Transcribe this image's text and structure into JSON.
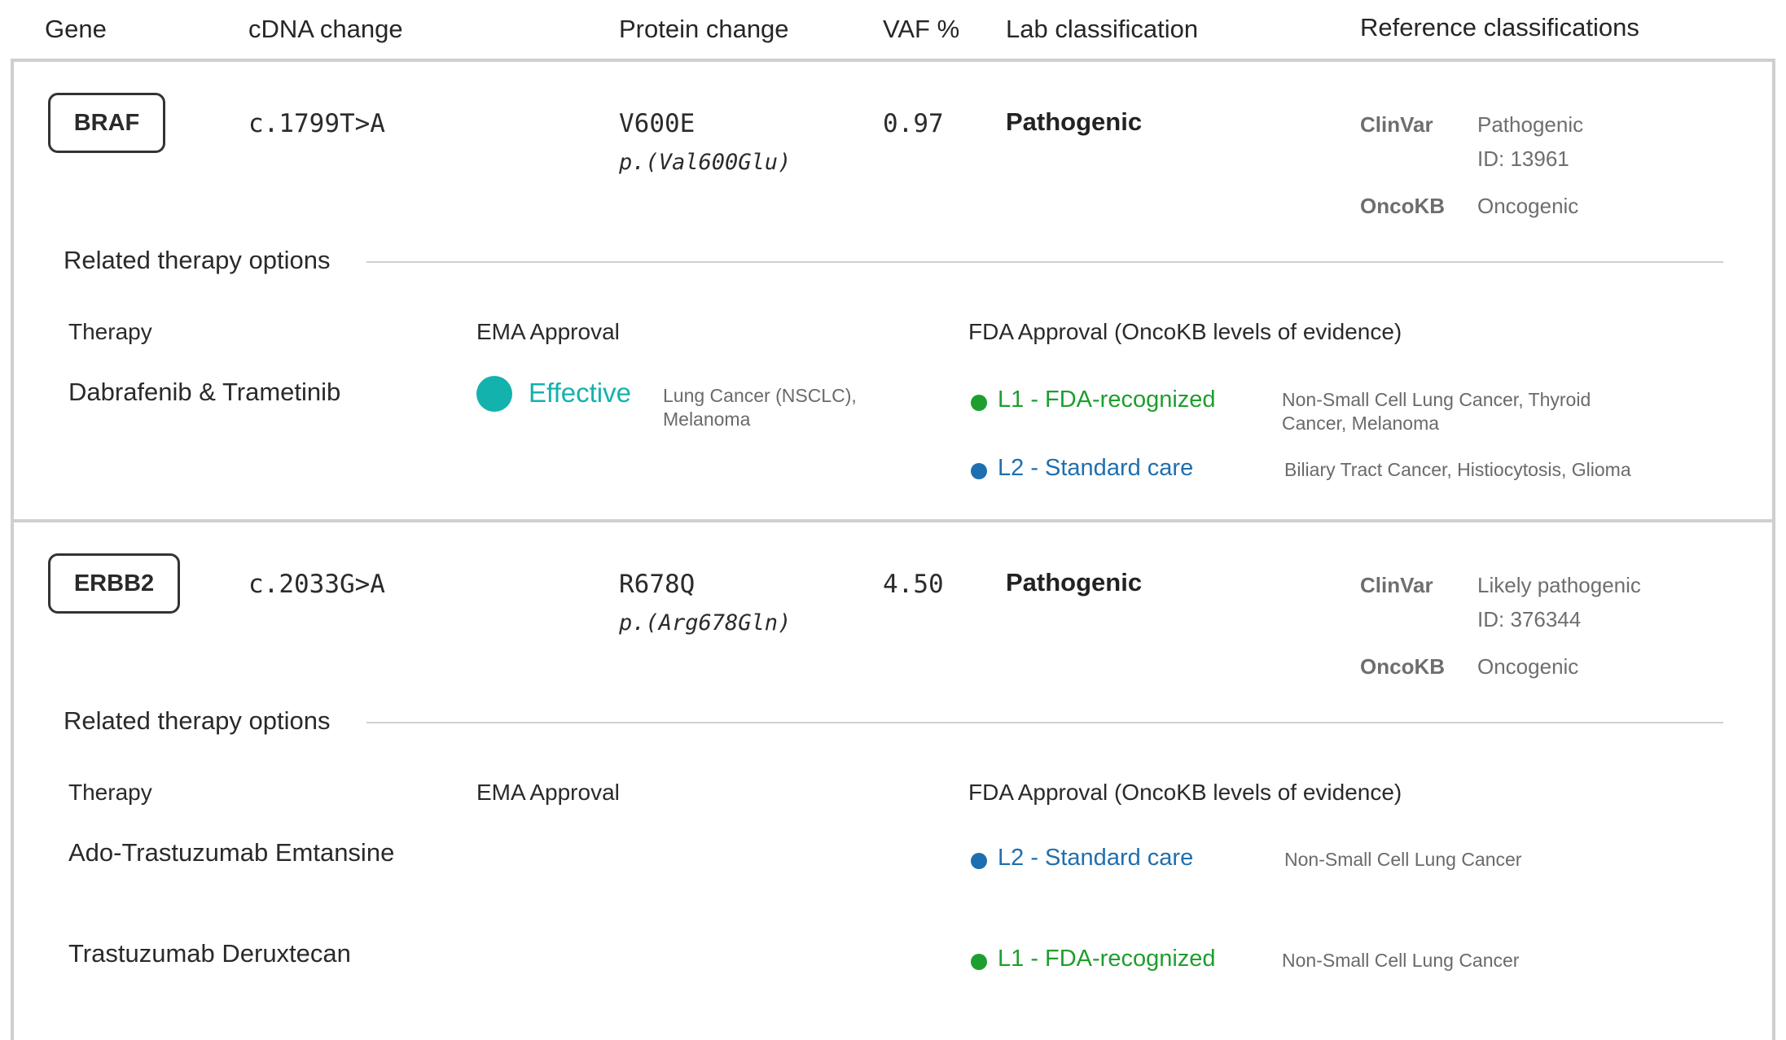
{
  "header": {
    "gene": "Gene",
    "cdna": "cDNA change",
    "protein": "Protein change",
    "vaf": "VAF %",
    "lab": "Lab classification",
    "reference": "Reference classifications"
  },
  "colors": {
    "ema_effective": "#14b2ad",
    "level_1": "#1e9e2e",
    "level_2": "#1e6fb0",
    "border": "#cfcfcf"
  },
  "variants": [
    {
      "gene": "BRAF",
      "cdna": "c.1799T>A",
      "protein_short": "V600E",
      "protein_long": "p.(Val600Glu)",
      "vaf": "0.97",
      "lab_classification": "Pathogenic",
      "clinvar_label": "ClinVar",
      "clinvar_value": "Pathogenic",
      "clinvar_id": "ID: 13961",
      "oncokb_label": "OncoKB",
      "oncokb_value": "Oncogenic",
      "related_title": "Related therapy options",
      "therapy_header": "Therapy",
      "ema_header": "EMA Approval",
      "fda_header": "FDA Approval (OncoKB levels of evidence)",
      "therapies": [
        {
          "name": "Dabrafenib & Trametinib",
          "ema_icon": "effective-dot",
          "ema_label": "Effective",
          "ema_indications": "Lung Cancer (NSCLC), Melanoma",
          "fda": [
            {
              "level": "L1 - FDA-recognized",
              "indications": "Non-Small Cell Lung Cancer, Thyroid Cancer, Melanoma"
            },
            {
              "level": "L2 - Standard care",
              "indications": "Biliary Tract Cancer, Histiocytosis, Glioma"
            }
          ]
        }
      ]
    },
    {
      "gene": "ERBB2",
      "cdna": "c.2033G>A",
      "protein_short": "R678Q",
      "protein_long": "p.(Arg678Gln)",
      "vaf": "4.50",
      "lab_classification": "Pathogenic",
      "clinvar_label": "ClinVar",
      "clinvar_value": "Likely pathogenic",
      "clinvar_id": "ID: 376344",
      "oncokb_label": "OncoKB",
      "oncokb_value": "Oncogenic",
      "related_title": "Related therapy options",
      "therapy_header": "Therapy",
      "ema_header": "EMA Approval",
      "fda_header": "FDA Approval (OncoKB levels of evidence)",
      "therapies": [
        {
          "name": "Ado-Trastuzumab Emtansine",
          "fda": [
            {
              "level": "L2 - Standard care",
              "indications": "Non-Small Cell Lung Cancer"
            }
          ]
        },
        {
          "name": "Trastuzumab Deruxtecan",
          "fda": [
            {
              "level": "L1 - FDA-recognized",
              "indications": "Non-Small Cell Lung Cancer"
            }
          ]
        }
      ]
    }
  ]
}
